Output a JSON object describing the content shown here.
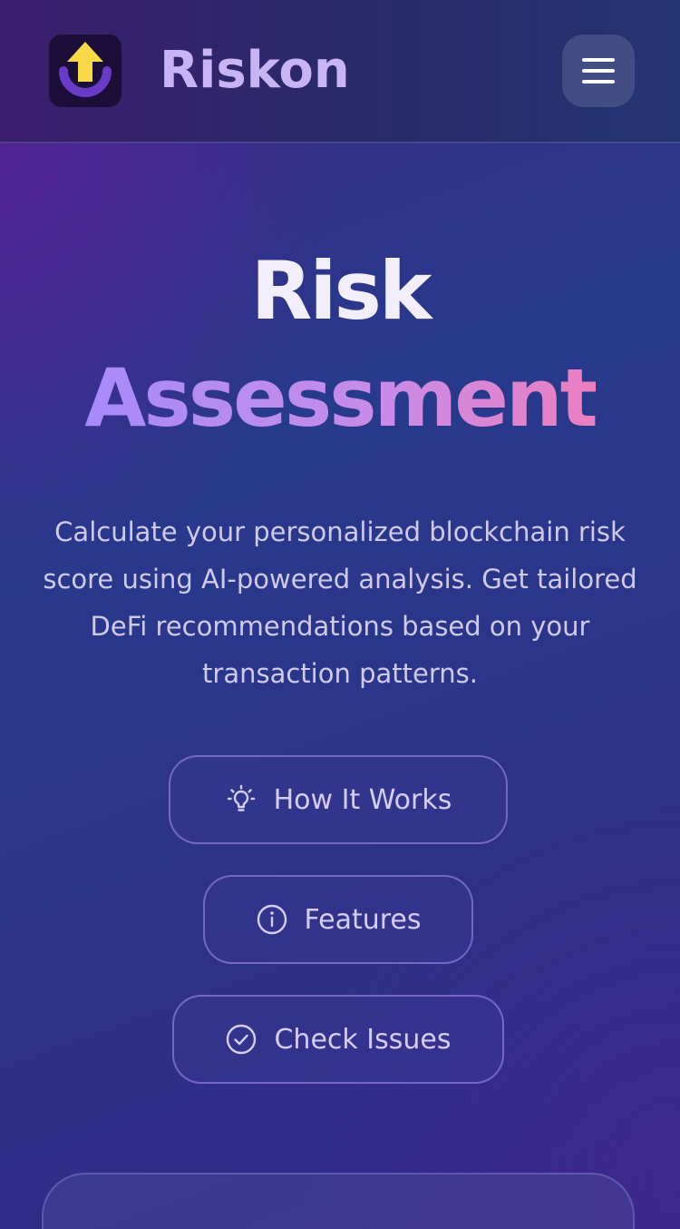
{
  "header": {
    "brand": "Riskon",
    "logo_icon": "up-arrow-refresh-logo",
    "menu_icon": "hamburger-menu-icon"
  },
  "hero": {
    "title_line1": "Risk",
    "title_line2": "Assessment",
    "subtitle": "Calculate your personalized blockchain risk score using AI-powered analysis. Get tailored DeFi recommendations based on your transaction patterns."
  },
  "actions": [
    {
      "label": "How It Works",
      "icon": "lightbulb-icon"
    },
    {
      "label": "Features",
      "icon": "info-icon"
    },
    {
      "label": "Check Issues",
      "icon": "check-circle-icon"
    }
  ],
  "colors": {
    "brand_text": "#c8b4f4",
    "accent_gradient_start": "#a78bfa",
    "accent_gradient_end": "#ec7fc0",
    "logo_arrow": "#f9d94a",
    "logo_ring": "#6a3bc7"
  }
}
